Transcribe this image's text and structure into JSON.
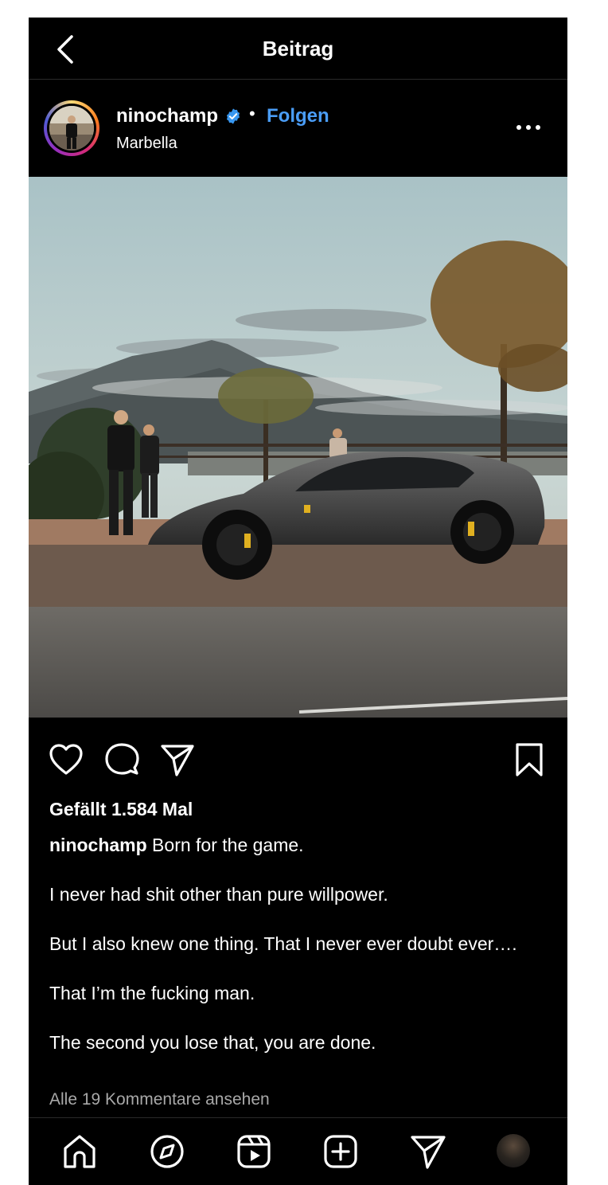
{
  "topbar": {
    "title": "Beitrag"
  },
  "post": {
    "username": "ninochamp",
    "separator": "•",
    "follow_label": "Folgen",
    "location": "Marbella",
    "likes_text": "Gefällt 1.584 Mal",
    "caption_user": "ninochamp",
    "caption_text": " Born for the game.\n\nI never had shit other than pure willpower.\n\nBut I also knew one thing. That I never ever doubt ever….\n\nThat I’m the fucking man.\n\nThe second you lose that, you are done.",
    "comments_link": "Alle 19 Kommentare ansehen"
  },
  "icons": {
    "back": "chevron-left-icon",
    "verified": "verified-badge-icon",
    "more": "more-options-icon",
    "like": "heart-icon",
    "comment": "comment-icon",
    "share": "paper-plane-icon",
    "save": "bookmark-icon",
    "nav": [
      "home-icon",
      "explore-compass-icon",
      "reels-icon",
      "create-plus-icon",
      "direct-messages-icon",
      "profile-avatar"
    ]
  },
  "colors": {
    "background": "#000000",
    "accent": "#4a9df7",
    "muted": "#a8a8a8",
    "verified": "#3897f0"
  }
}
